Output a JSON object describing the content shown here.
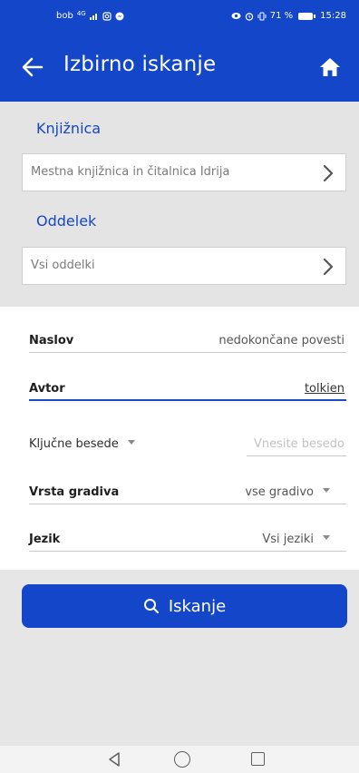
{
  "status_bar": {
    "carrier": "bob",
    "signal": "4G",
    "battery_percent": "71 %",
    "time": "15:28"
  },
  "app_bar": {
    "title": "Izbirno iskanje",
    "back_icon": "arrow-left-icon",
    "home_icon": "home-icon"
  },
  "library": {
    "label": "Knjižnica",
    "value": "Mestna knjižnica in čitalnica Idrija"
  },
  "department": {
    "label": "Oddelek",
    "value": "Vsi oddelki"
  },
  "form": {
    "title": {
      "label": "Naslov",
      "value": "nedokončane povesti"
    },
    "author": {
      "label": "Avtor",
      "value": "tolkien"
    },
    "keywords": {
      "label": "Ključne besede",
      "placeholder": "Vnesite besedo"
    },
    "material_type": {
      "label": "Vrsta gradiva",
      "value": "vse gradivo"
    },
    "language": {
      "label": "Jezik",
      "value": "Vsi jeziki"
    }
  },
  "search": {
    "label": "Iskanje",
    "icon": "search-icon"
  },
  "colors": {
    "primary": "#1346c8",
    "section_label": "#1747c0",
    "panel_bg": "#e4e4e4"
  }
}
